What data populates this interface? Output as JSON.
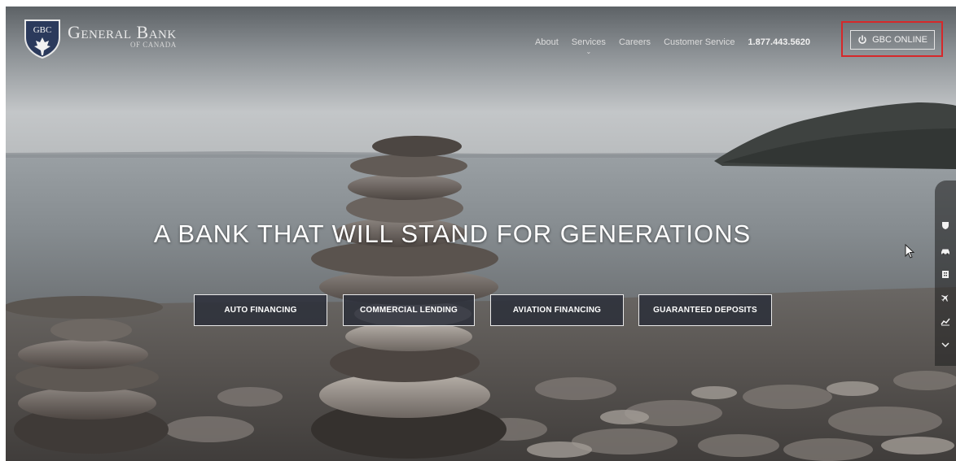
{
  "header": {
    "logo_badge": "GBC",
    "logo_name": "General Bank",
    "logo_sub": "OF CANADA",
    "nav": [
      {
        "label": "About"
      },
      {
        "label": "Services"
      },
      {
        "label": "Careers"
      },
      {
        "label": "Customer Service"
      }
    ],
    "services_chevron": "⌄",
    "phone": "1.877.443.5620",
    "online_button": "GBC ONLINE",
    "online_icon": "power-icon"
  },
  "hero": {
    "headline": "A BANK THAT WILL STAND FOR GENERATIONS",
    "buttons": [
      {
        "label": "AUTO FINANCING"
      },
      {
        "label": "COMMERCIAL LENDING"
      },
      {
        "label": "AVIATION FINANCING"
      },
      {
        "label": "GUARANTEED DEPOSITS"
      }
    ]
  },
  "side_rail": {
    "icons": [
      "shield-icon",
      "car-icon",
      "building-icon",
      "plane-icon",
      "chart-icon",
      "chevron-down-icon"
    ]
  },
  "colors": {
    "highlight_outline": "#d6282a",
    "cta_background": "#2c303a"
  }
}
